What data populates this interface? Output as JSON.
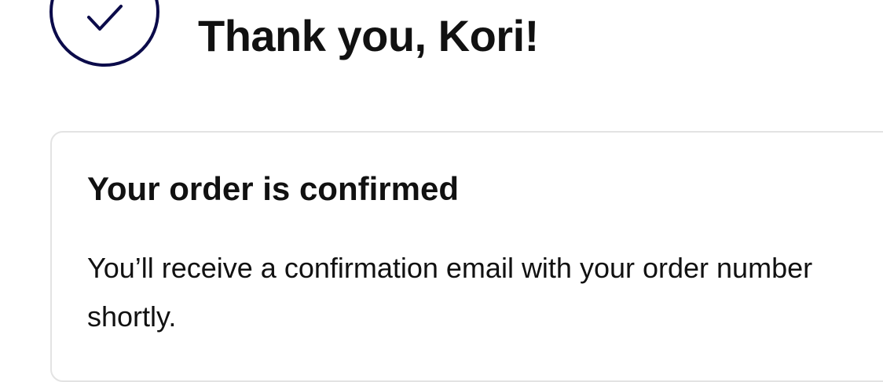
{
  "header": {
    "icon": "check-circle-icon",
    "title": "Thank you, Kori!"
  },
  "confirmation_card": {
    "heading": "Your order is confirmed",
    "message": "You’ll receive a confirmation email with your order number shortly."
  },
  "colors": {
    "icon_stroke": "#0b0b4a",
    "text": "#111111",
    "card_border": "#e3e3e3",
    "background": "#ffffff"
  }
}
